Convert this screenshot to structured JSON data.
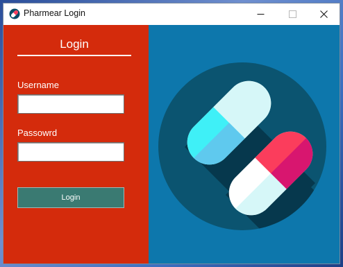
{
  "window": {
    "title": "Pharmear Login",
    "controls": {
      "minimize": "minimize-icon",
      "maximize": "maximize-icon",
      "close": "close-icon"
    }
  },
  "login_panel": {
    "heading": "Login",
    "username_label": "Username",
    "username_value": "",
    "password_label": "Passowrd",
    "password_value": "",
    "submit_label": "Login"
  },
  "illustration": {
    "icon": "pills-icon"
  },
  "colors": {
    "left_panel": "#d42b0c",
    "right_panel": "#0d77ac",
    "circle": "#0b5470",
    "login_button": "#3a7a72",
    "pill_cyan": "#3ff0f7",
    "pill_red": "#fb3d5c"
  }
}
